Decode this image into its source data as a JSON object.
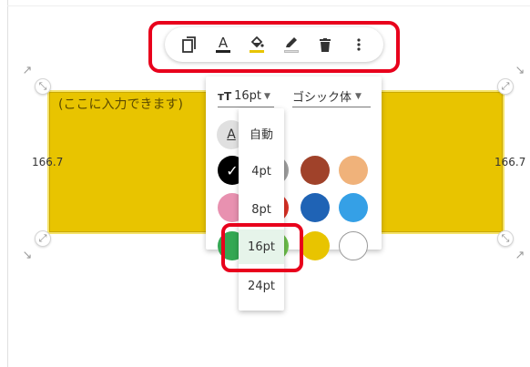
{
  "shape": {
    "placeholder_text": "(ここに入力できます)",
    "width_label_left": "166.7",
    "width_label_right": "166.7",
    "fill_color": "#e8c400"
  },
  "toolbar": {
    "buttons": [
      {
        "name": "copy-icon",
        "label": "copy"
      },
      {
        "name": "text-color-icon",
        "label": "A",
        "bar_color": "#222222"
      },
      {
        "name": "fill-color-icon",
        "label": "fill",
        "bar_color": "#e8c400"
      },
      {
        "name": "line-color-icon",
        "label": "line",
        "bar_color": "#cccccc"
      },
      {
        "name": "delete-icon",
        "label": "delete"
      },
      {
        "name": "more-icon",
        "label": "more"
      }
    ]
  },
  "panel": {
    "font_size_value": "16pt",
    "font_family_value": "ゴシック体",
    "text_color_glyph": "A",
    "swatches": [
      {
        "color": "#000000",
        "selected": true
      },
      {
        "color": "#9e9e9e"
      },
      {
        "color": "#a0422a"
      },
      {
        "color": "#f0b27a"
      },
      {
        "color": "#e891b0"
      },
      {
        "color": "#d93025"
      },
      {
        "color": "#1f63b5"
      },
      {
        "color": "#35a0e6"
      },
      {
        "color": "#34a853"
      },
      {
        "color": "#6cbf4a"
      },
      {
        "color": "#e8c400"
      },
      {
        "color": "#ffffff"
      }
    ]
  },
  "dropdown": {
    "items": [
      "自動",
      "4pt",
      "8pt",
      "16pt",
      "24pt"
    ],
    "selected": "16pt"
  },
  "annotations": {
    "highlight_color": "#e8001c"
  }
}
